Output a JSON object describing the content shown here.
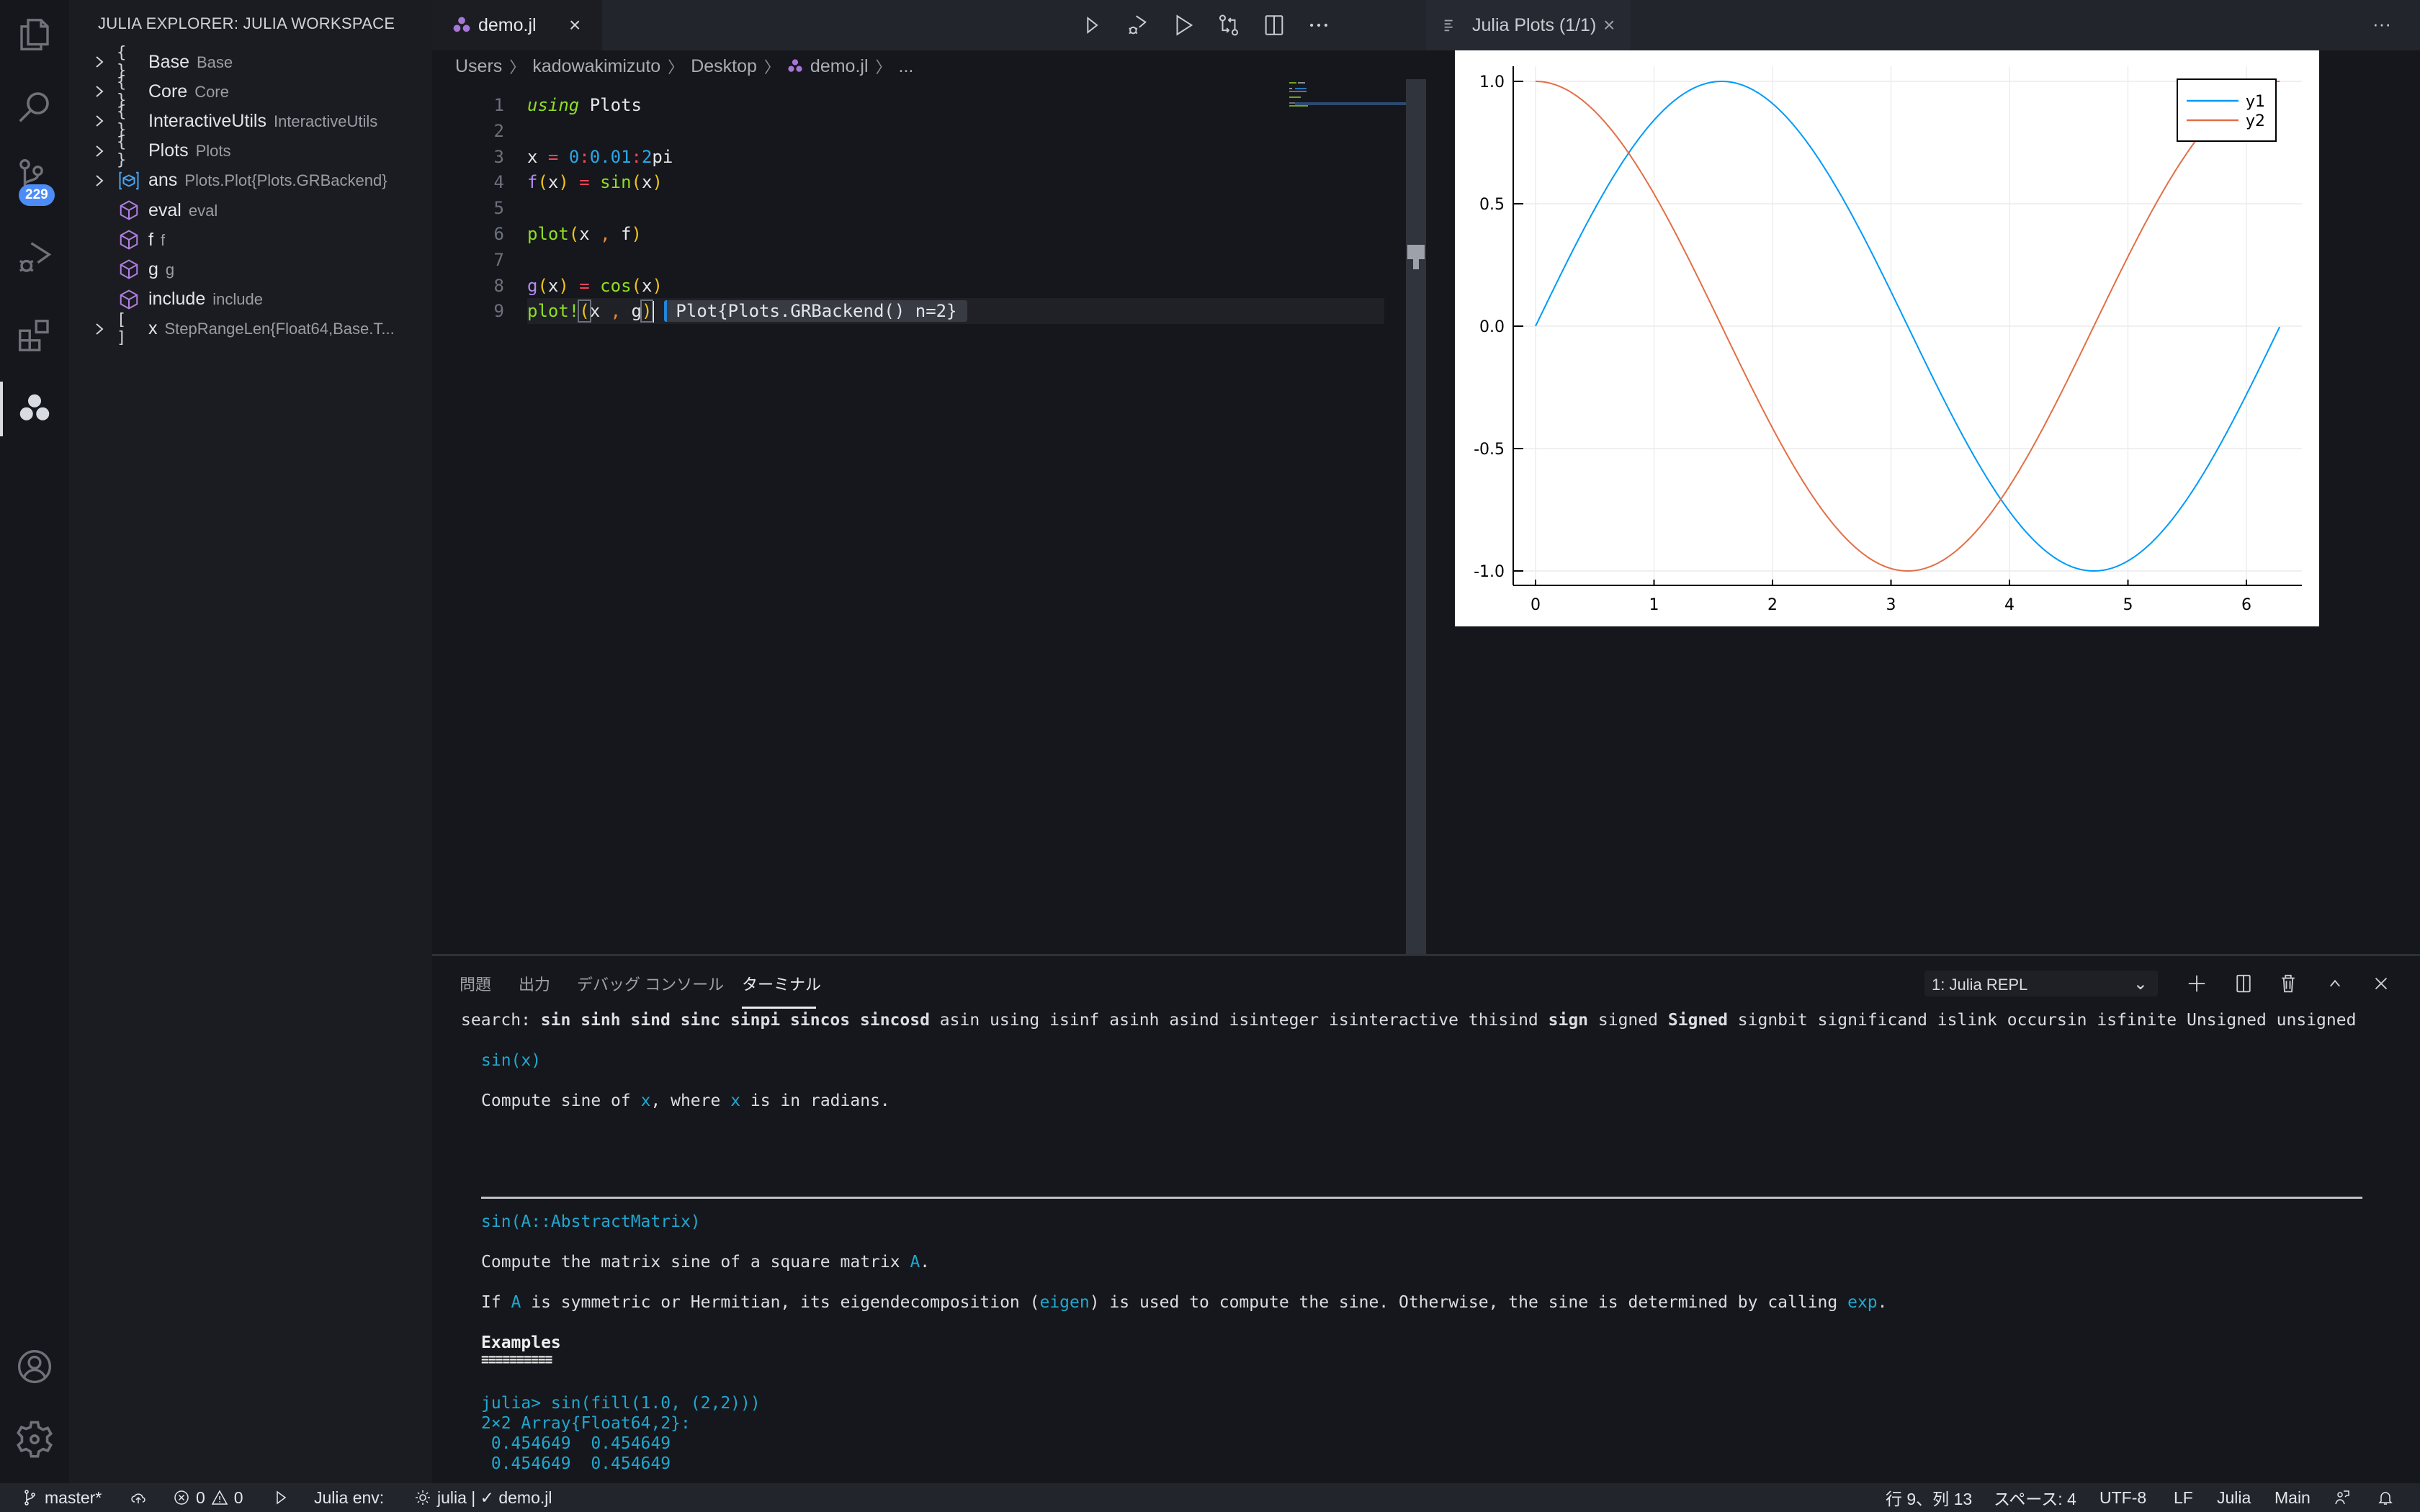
{
  "activity_bar": {
    "items": [
      {
        "name": "explorer",
        "icon": "files-icon"
      },
      {
        "name": "search",
        "icon": "search-icon"
      },
      {
        "name": "source-control",
        "icon": "source-control-icon",
        "badge": "229"
      },
      {
        "name": "run-debug",
        "icon": "run-debug-icon"
      },
      {
        "name": "extensions",
        "icon": "extensions-icon"
      },
      {
        "name": "julia",
        "icon": "julia-icon",
        "active": true
      }
    ],
    "bottom": [
      {
        "name": "accounts",
        "icon": "account-icon"
      },
      {
        "name": "manage",
        "icon": "gear-icon"
      }
    ]
  },
  "sidebar": {
    "title": "JULIA EXPLORER: JULIA WORKSPACE",
    "items": [
      {
        "name": "Base",
        "desc": "Base",
        "kind": "module",
        "expandable": true
      },
      {
        "name": "Core",
        "desc": "Core",
        "kind": "module",
        "expandable": true
      },
      {
        "name": "InteractiveUtils",
        "desc": "InteractiveUtils",
        "kind": "module",
        "expandable": true
      },
      {
        "name": "Plots",
        "desc": "Plots",
        "kind": "module",
        "expandable": true
      },
      {
        "name": "ans",
        "desc": "Plots.Plot{Plots.GRBackend}",
        "kind": "struct",
        "expandable": true
      },
      {
        "name": "eval",
        "desc": "eval",
        "kind": "function",
        "expandable": false
      },
      {
        "name": "f",
        "desc": "f",
        "kind": "function",
        "expandable": false
      },
      {
        "name": "g",
        "desc": "g",
        "kind": "function",
        "expandable": false
      },
      {
        "name": "include",
        "desc": "include",
        "kind": "function",
        "expandable": false
      },
      {
        "name": "x",
        "desc": "StepRangeLen{Float64,Base.T...",
        "kind": "array",
        "expandable": true
      }
    ]
  },
  "editor": {
    "tab": {
      "label": "demo.jl",
      "close": "×"
    },
    "toolbar": [
      "run-icon",
      "debug-run-icon",
      "run-file-icon",
      "compare-changes-icon",
      "split-editor-icon",
      "more-icon"
    ],
    "breadcrumb": [
      "Users",
      "kadowakimizuto",
      "Desktop",
      "demo.jl",
      "..."
    ],
    "lines": [
      {
        "n": "1",
        "tokens": [
          [
            "kw",
            "using"
          ],
          [
            "plain",
            " Plots"
          ]
        ]
      },
      {
        "n": "2",
        "tokens": []
      },
      {
        "n": "3",
        "tokens": [
          [
            "plain",
            "x "
          ],
          [
            "op",
            "="
          ],
          [
            "plain",
            " "
          ],
          [
            "num",
            "0"
          ],
          [
            "op",
            ":"
          ],
          [
            "num",
            "0.01"
          ],
          [
            "op",
            ":"
          ],
          [
            "num",
            "2"
          ],
          [
            "plain",
            "pi"
          ]
        ]
      },
      {
        "n": "4",
        "tokens": [
          [
            "def",
            "f"
          ],
          [
            "par",
            "("
          ],
          [
            "plain",
            "x"
          ],
          [
            "par",
            ")"
          ],
          [
            "plain",
            " "
          ],
          [
            "op",
            "="
          ],
          [
            "plain",
            " "
          ],
          [
            "fn",
            "sin"
          ],
          [
            "par",
            "("
          ],
          [
            "plain",
            "x"
          ],
          [
            "par",
            ")"
          ]
        ]
      },
      {
        "n": "5",
        "tokens": []
      },
      {
        "n": "6",
        "tokens": [
          [
            "fn",
            "plot"
          ],
          [
            "par",
            "("
          ],
          [
            "plain",
            "x "
          ],
          [
            "comma",
            ","
          ],
          [
            "plain",
            " f"
          ],
          [
            "par",
            ")"
          ]
        ]
      },
      {
        "n": "7",
        "tokens": []
      },
      {
        "n": "8",
        "tokens": [
          [
            "def",
            "g"
          ],
          [
            "par",
            "("
          ],
          [
            "plain",
            "x"
          ],
          [
            "par",
            ")"
          ],
          [
            "plain",
            " "
          ],
          [
            "op",
            "="
          ],
          [
            "plain",
            " "
          ],
          [
            "fn",
            "cos"
          ],
          [
            "par",
            "("
          ],
          [
            "plain",
            "x"
          ],
          [
            "par",
            ")"
          ]
        ]
      },
      {
        "n": "9",
        "tokens": [
          [
            "fn",
            "plot!"
          ],
          [
            "parbox",
            "("
          ],
          [
            "plain",
            "x "
          ],
          [
            "comma",
            ","
          ],
          [
            "plain",
            " g"
          ],
          [
            "parbox",
            ")"
          ]
        ],
        "current": true,
        "inline_result": "Plot{Plots.GRBackend() n=2}"
      }
    ]
  },
  "plot_pane": {
    "tab": {
      "label": "Julia Plots (1/1)",
      "close": "×"
    },
    "more": "···"
  },
  "chart_data": {
    "type": "line",
    "title": "",
    "xlabel": "",
    "ylabel": "",
    "x": {
      "start": 0,
      "step": 0.01,
      "stop": 6.283185307
    },
    "series": [
      {
        "name": "y1",
        "function": "sin(x)",
        "color": "#009af9"
      },
      {
        "name": "y2",
        "function": "cos(x)",
        "color": "#e26f46"
      }
    ],
    "xlim": [
      -0.19,
      6.47
    ],
    "ylim": [
      -1.06,
      1.06
    ],
    "xticks": [
      0,
      1,
      2,
      3,
      4,
      5,
      6
    ],
    "xtick_labels": [
      "0",
      "1",
      "2",
      "3",
      "4",
      "5",
      "6"
    ],
    "yticks": [
      -1.0,
      -0.5,
      0.0,
      0.5,
      1.0
    ],
    "ytick_labels": [
      "-1.0",
      "-0.5",
      "0.0",
      "0.5",
      "1.0"
    ],
    "grid": true,
    "legend": "top-right"
  },
  "panel": {
    "tabs": [
      "問題",
      "出力",
      "デバッグ コンソール",
      "ターミナル"
    ],
    "active_tab": 3,
    "terminal_select": "1: Julia REPL",
    "actions": [
      "add-terminal-icon",
      "split-terminal-icon",
      "trash-icon",
      "maximize-icon",
      "close-icon"
    ],
    "terminal": {
      "search_prefix": "search: ",
      "search_words": [
        "sin",
        "sinh",
        "sind",
        "sinc",
        "sinpi",
        "sincos",
        "sincosd",
        "asin",
        "using",
        "isinf",
        "asinh",
        "asind",
        "isinteger",
        "isinteractive",
        "thisind",
        "sign",
        "signed",
        "Signed",
        "signbit",
        "significand",
        "islink",
        "occursin",
        "isfinite",
        "Unsigned",
        "unsigned"
      ],
      "sig1": "sin(x)",
      "desc1_a": "Compute sine of ",
      "desc1_x1": "x",
      "desc1_b": ", where ",
      "desc1_x2": "x",
      "desc1_c": " is in radians.",
      "sig2": "sin(A::AbstractMatrix)",
      "desc2_a": "Compute the matrix sine of a square matrix ",
      "desc2_A": "A",
      "desc2_b": ".",
      "desc3_a": "If ",
      "desc3_A": "A",
      "desc3_b": " is symmetric or Hermitian, its eigendecomposition (",
      "desc3_eigen": "eigen",
      "desc3_c": ") is used to compute the sine. Otherwise, the sine is determined by calling ",
      "desc3_exp": "exp",
      "desc3_d": ".",
      "examples_heading": "Examples",
      "examples_rule": "≡≡≡≡≡≡≡≡≡≡",
      "ex_input": "julia> sin(fill(1.0, (2,2)))",
      "ex_out1": "2×2 Array{Float64,2}:",
      "ex_out2": " 0.454649  0.454649",
      "ex_out3": " 0.454649  0.454649",
      "prompt": "julia>"
    }
  },
  "status_bar": {
    "branch": "master*",
    "errors": "0",
    "warnings": "0",
    "julia_env_label": "Julia env:",
    "julia_env_value": "julia | ✓ demo.jl",
    "position": "行 9、列 13",
    "spaces": "スペース: 4",
    "encoding": "UTF-8",
    "eol": "LF",
    "language": "Julia",
    "module": "Main"
  }
}
